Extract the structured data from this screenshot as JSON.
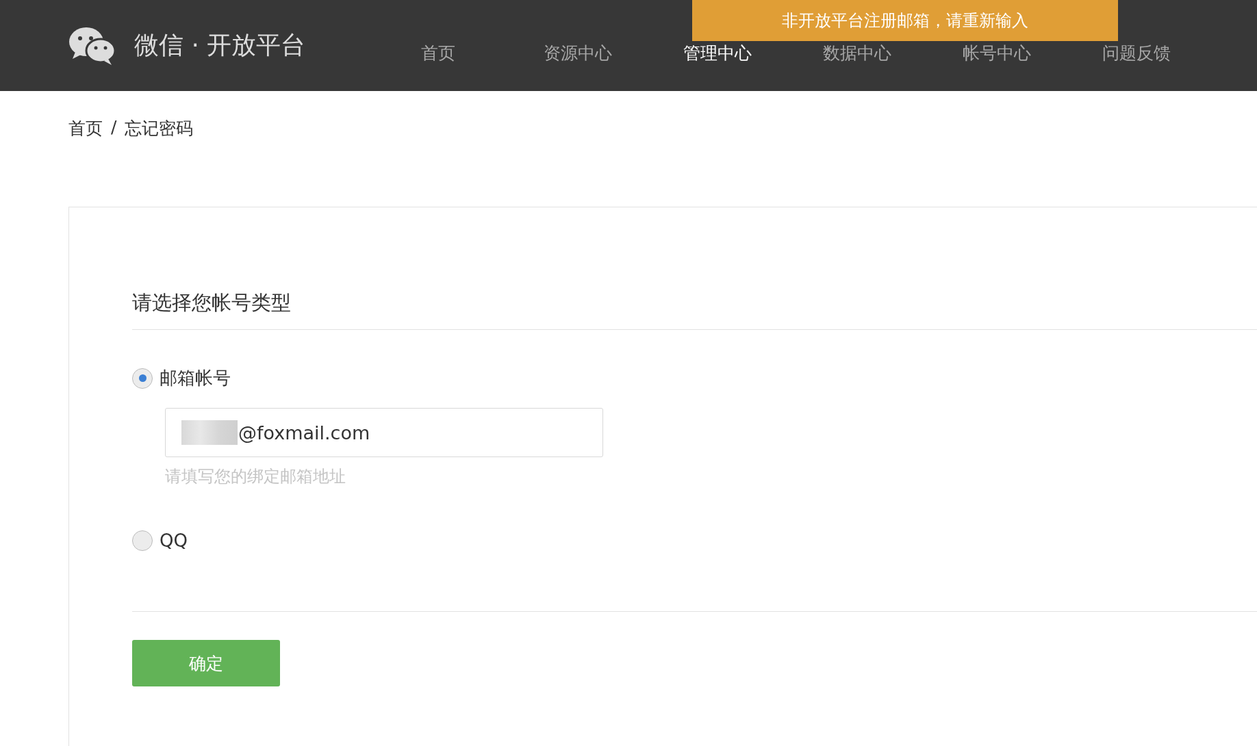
{
  "header": {
    "logo": "微信 · 开放平台",
    "nav": [
      {
        "label": "首页",
        "selected": false
      },
      {
        "label": "资源中心",
        "selected": false
      },
      {
        "label": "管理中心",
        "selected": true
      },
      {
        "label": "数据中心",
        "selected": false
      },
      {
        "label": "帐号中心",
        "selected": false
      },
      {
        "label": "问题反馈",
        "selected": false
      }
    ]
  },
  "toast": "非开放平台注册邮箱，请重新输入",
  "breadcrumb": [
    {
      "label": "首页"
    },
    {
      "label": "忘记密码"
    }
  ],
  "breadcrumb_separator": "/",
  "form": {
    "title": "请选择您帐号类型",
    "options": [
      {
        "label": "邮箱帐号",
        "selected": true,
        "field": {
          "value": "@foxmail.com",
          "hint": "请填写您的绑定邮箱地址"
        }
      },
      {
        "label": "QQ",
        "selected": false
      }
    ],
    "submit": "确定"
  }
}
